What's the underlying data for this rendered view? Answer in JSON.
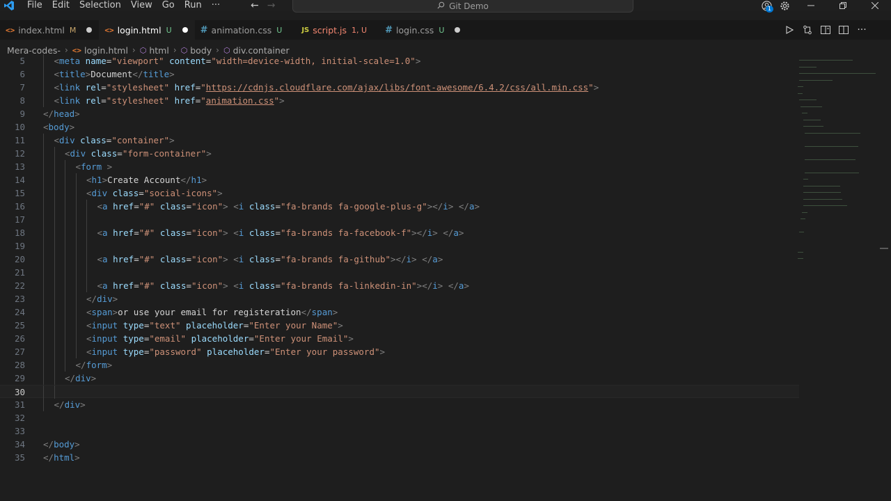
{
  "menu": [
    "File",
    "Edit",
    "Selection",
    "View",
    "Go",
    "Run",
    "···"
  ],
  "command_center": {
    "label": "Git Demo"
  },
  "account_badge": "1",
  "tabs": [
    {
      "label": "index.html",
      "status": "M",
      "kind": "html",
      "active": false,
      "dirty": true
    },
    {
      "label": "login.html",
      "status": "U",
      "kind": "html",
      "active": true,
      "dirty": true
    },
    {
      "label": "animation.css",
      "status": "U",
      "kind": "css",
      "active": false,
      "dirty": false
    },
    {
      "label": "script.js",
      "status": "1, U",
      "kind": "js",
      "active": false,
      "dirty": false
    },
    {
      "label": "login.css",
      "status": "U",
      "kind": "css",
      "active": false,
      "dirty": true
    }
  ],
  "breadcrumb": {
    "folder": "Mera-codes-",
    "file": "login.html",
    "html": "html",
    "body": "body",
    "div": "div.container"
  },
  "editor": {
    "current_line": "30",
    "lines": [
      {
        "n": "5",
        "indent": 1,
        "tokens": [
          [
            "br",
            "<"
          ],
          [
            "tag",
            "meta"
          ],
          [
            "t",
            " "
          ],
          [
            "attr",
            "name"
          ],
          [
            "eq",
            "="
          ],
          [
            "str",
            "\"viewport\""
          ],
          [
            "t",
            " "
          ],
          [
            "attr",
            "content"
          ],
          [
            "eq",
            "="
          ],
          [
            "str",
            "\"width=device-width, initial-scale=1.0\""
          ],
          [
            "br",
            ">"
          ]
        ]
      },
      {
        "n": "6",
        "indent": 1,
        "tokens": [
          [
            "br",
            "<"
          ],
          [
            "tag",
            "title"
          ],
          [
            "br",
            ">"
          ],
          [
            "t",
            "Document"
          ],
          [
            "br",
            "</"
          ],
          [
            "tag",
            "title"
          ],
          [
            "br",
            ">"
          ]
        ]
      },
      {
        "n": "7",
        "indent": 1,
        "tokens": [
          [
            "br",
            "<"
          ],
          [
            "tag",
            "link"
          ],
          [
            "t",
            " "
          ],
          [
            "attr",
            "rel"
          ],
          [
            "eq",
            "="
          ],
          [
            "str",
            "\"stylesheet\""
          ],
          [
            "t",
            " "
          ],
          [
            "attr",
            "href"
          ],
          [
            "eq",
            "="
          ],
          [
            "str",
            "\""
          ],
          [
            "link",
            "https://cdnjs.cloudflare.com/ajax/libs/font-awesome/6.4.2/css/all.min.css"
          ],
          [
            "str",
            "\""
          ],
          [
            "br",
            ">"
          ]
        ]
      },
      {
        "n": "8",
        "indent": 1,
        "tokens": [
          [
            "br",
            "<"
          ],
          [
            "tag",
            "link"
          ],
          [
            "t",
            " "
          ],
          [
            "attr",
            "rel"
          ],
          [
            "eq",
            "="
          ],
          [
            "str",
            "\"stylesheet\""
          ],
          [
            "t",
            " "
          ],
          [
            "attr",
            "href"
          ],
          [
            "eq",
            "="
          ],
          [
            "str",
            "\""
          ],
          [
            "link",
            "animation.css"
          ],
          [
            "str",
            "\""
          ],
          [
            "br",
            ">"
          ]
        ]
      },
      {
        "n": "9",
        "indent": 0,
        "tokens": [
          [
            "br",
            "</"
          ],
          [
            "tag",
            "head"
          ],
          [
            "br",
            ">"
          ]
        ]
      },
      {
        "n": "10",
        "indent": 0,
        "tokens": [
          [
            "br",
            "<"
          ],
          [
            "tag",
            "body"
          ],
          [
            "br",
            ">"
          ]
        ]
      },
      {
        "n": "11",
        "indent": 1,
        "tokens": [
          [
            "br",
            "<"
          ],
          [
            "tag",
            "div"
          ],
          [
            "t",
            " "
          ],
          [
            "attr",
            "class"
          ],
          [
            "eq",
            "="
          ],
          [
            "str",
            "\"container\""
          ],
          [
            "br",
            ">"
          ]
        ]
      },
      {
        "n": "12",
        "indent": 2,
        "tokens": [
          [
            "br",
            "<"
          ],
          [
            "tag",
            "div"
          ],
          [
            "t",
            " "
          ],
          [
            "attr",
            "class"
          ],
          [
            "eq",
            "="
          ],
          [
            "str",
            "\"form-container\""
          ],
          [
            "br",
            ">"
          ]
        ]
      },
      {
        "n": "13",
        "indent": 3,
        "tokens": [
          [
            "br",
            "<"
          ],
          [
            "tag",
            "form"
          ],
          [
            "t",
            " "
          ],
          [
            "br",
            ">"
          ]
        ]
      },
      {
        "n": "14",
        "indent": 4,
        "tokens": [
          [
            "br",
            "<"
          ],
          [
            "tag",
            "h1"
          ],
          [
            "br",
            ">"
          ],
          [
            "t",
            "Create Account"
          ],
          [
            "br",
            "</"
          ],
          [
            "tag",
            "h1"
          ],
          [
            "br",
            ">"
          ]
        ]
      },
      {
        "n": "15",
        "indent": 4,
        "tokens": [
          [
            "br",
            "<"
          ],
          [
            "tag",
            "div"
          ],
          [
            "t",
            " "
          ],
          [
            "attr",
            "class"
          ],
          [
            "eq",
            "="
          ],
          [
            "str",
            "\"social-icons\""
          ],
          [
            "br",
            ">"
          ]
        ]
      },
      {
        "n": "16",
        "indent": 5,
        "tokens": [
          [
            "br",
            "<"
          ],
          [
            "tag",
            "a"
          ],
          [
            "t",
            " "
          ],
          [
            "attr",
            "href"
          ],
          [
            "eq",
            "="
          ],
          [
            "str",
            "\"#\""
          ],
          [
            "t",
            " "
          ],
          [
            "attr",
            "class"
          ],
          [
            "eq",
            "="
          ],
          [
            "str",
            "\"icon\""
          ],
          [
            "br",
            ">"
          ],
          [
            "t",
            " "
          ],
          [
            "br",
            "<"
          ],
          [
            "tag",
            "i"
          ],
          [
            "t",
            " "
          ],
          [
            "attr",
            "class"
          ],
          [
            "eq",
            "="
          ],
          [
            "str",
            "\"fa-brands fa-google-plus-g\""
          ],
          [
            "br",
            "></"
          ],
          [
            "tag",
            "i"
          ],
          [
            "br",
            ">"
          ],
          [
            "t",
            " "
          ],
          [
            "br",
            "</"
          ],
          [
            "tag",
            "a"
          ],
          [
            "br",
            ">"
          ]
        ]
      },
      {
        "n": "17",
        "indent": 5,
        "tokens": []
      },
      {
        "n": "18",
        "indent": 5,
        "tokens": [
          [
            "br",
            "<"
          ],
          [
            "tag",
            "a"
          ],
          [
            "t",
            " "
          ],
          [
            "attr",
            "href"
          ],
          [
            "eq",
            "="
          ],
          [
            "str",
            "\"#\""
          ],
          [
            "t",
            " "
          ],
          [
            "attr",
            "class"
          ],
          [
            "eq",
            "="
          ],
          [
            "str",
            "\"icon\""
          ],
          [
            "br",
            ">"
          ],
          [
            "t",
            " "
          ],
          [
            "br",
            "<"
          ],
          [
            "tag",
            "i"
          ],
          [
            "t",
            " "
          ],
          [
            "attr",
            "class"
          ],
          [
            "eq",
            "="
          ],
          [
            "str",
            "\"fa-brands fa-facebook-f\""
          ],
          [
            "br",
            "></"
          ],
          [
            "tag",
            "i"
          ],
          [
            "br",
            ">"
          ],
          [
            "t",
            " "
          ],
          [
            "br",
            "</"
          ],
          [
            "tag",
            "a"
          ],
          [
            "br",
            ">"
          ]
        ]
      },
      {
        "n": "19",
        "indent": 5,
        "tokens": []
      },
      {
        "n": "20",
        "indent": 5,
        "tokens": [
          [
            "br",
            "<"
          ],
          [
            "tag",
            "a"
          ],
          [
            "t",
            " "
          ],
          [
            "attr",
            "href"
          ],
          [
            "eq",
            "="
          ],
          [
            "str",
            "\"#\""
          ],
          [
            "t",
            " "
          ],
          [
            "attr",
            "class"
          ],
          [
            "eq",
            "="
          ],
          [
            "str",
            "\"icon\""
          ],
          [
            "br",
            ">"
          ],
          [
            "t",
            " "
          ],
          [
            "br",
            "<"
          ],
          [
            "tag",
            "i"
          ],
          [
            "t",
            " "
          ],
          [
            "attr",
            "class"
          ],
          [
            "eq",
            "="
          ],
          [
            "str",
            "\"fa-brands fa-github\""
          ],
          [
            "br",
            "></"
          ],
          [
            "tag",
            "i"
          ],
          [
            "br",
            ">"
          ],
          [
            "t",
            " "
          ],
          [
            "br",
            "</"
          ],
          [
            "tag",
            "a"
          ],
          [
            "br",
            ">"
          ]
        ]
      },
      {
        "n": "21",
        "indent": 5,
        "tokens": []
      },
      {
        "n": "22",
        "indent": 5,
        "tokens": [
          [
            "br",
            "<"
          ],
          [
            "tag",
            "a"
          ],
          [
            "t",
            " "
          ],
          [
            "attr",
            "href"
          ],
          [
            "eq",
            "="
          ],
          [
            "str",
            "\"#\""
          ],
          [
            "t",
            " "
          ],
          [
            "attr",
            "class"
          ],
          [
            "eq",
            "="
          ],
          [
            "str",
            "\"icon\""
          ],
          [
            "br",
            ">"
          ],
          [
            "t",
            " "
          ],
          [
            "br",
            "<"
          ],
          [
            "tag",
            "i"
          ],
          [
            "t",
            " "
          ],
          [
            "attr",
            "class"
          ],
          [
            "eq",
            "="
          ],
          [
            "str",
            "\"fa-brands fa-linkedin-in\""
          ],
          [
            "br",
            "></"
          ],
          [
            "tag",
            "i"
          ],
          [
            "br",
            ">"
          ],
          [
            "t",
            " "
          ],
          [
            "br",
            "</"
          ],
          [
            "tag",
            "a"
          ],
          [
            "br",
            ">"
          ]
        ]
      },
      {
        "n": "23",
        "indent": 4,
        "tokens": [
          [
            "br",
            "</"
          ],
          [
            "tag",
            "div"
          ],
          [
            "br",
            ">"
          ]
        ]
      },
      {
        "n": "24",
        "indent": 4,
        "tokens": [
          [
            "br",
            "<"
          ],
          [
            "tag",
            "span"
          ],
          [
            "br",
            ">"
          ],
          [
            "t",
            "or use your email for registeration"
          ],
          [
            "br",
            "</"
          ],
          [
            "tag",
            "span"
          ],
          [
            "br",
            ">"
          ]
        ]
      },
      {
        "n": "25",
        "indent": 4,
        "tokens": [
          [
            "br",
            "<"
          ],
          [
            "tag",
            "input"
          ],
          [
            "t",
            " "
          ],
          [
            "attr",
            "type"
          ],
          [
            "eq",
            "="
          ],
          [
            "str",
            "\"text\""
          ],
          [
            "t",
            " "
          ],
          [
            "attr",
            "placeholder"
          ],
          [
            "eq",
            "="
          ],
          [
            "str",
            "\"Enter your Name\""
          ],
          [
            "br",
            ">"
          ]
        ]
      },
      {
        "n": "26",
        "indent": 4,
        "tokens": [
          [
            "br",
            "<"
          ],
          [
            "tag",
            "input"
          ],
          [
            "t",
            " "
          ],
          [
            "attr",
            "type"
          ],
          [
            "eq",
            "="
          ],
          [
            "str",
            "\"email\""
          ],
          [
            "t",
            " "
          ],
          [
            "attr",
            "placeholder"
          ],
          [
            "eq",
            "="
          ],
          [
            "str",
            "\"Enter your Email\""
          ],
          [
            "br",
            ">"
          ]
        ]
      },
      {
        "n": "27",
        "indent": 4,
        "tokens": [
          [
            "br",
            "<"
          ],
          [
            "tag",
            "input"
          ],
          [
            "t",
            " "
          ],
          [
            "attr",
            "type"
          ],
          [
            "eq",
            "="
          ],
          [
            "str",
            "\"password\""
          ],
          [
            "t",
            " "
          ],
          [
            "attr",
            "placeholder"
          ],
          [
            "eq",
            "="
          ],
          [
            "str",
            "\"Enter your password\""
          ],
          [
            "br",
            ">"
          ]
        ]
      },
      {
        "n": "28",
        "indent": 3,
        "tokens": [
          [
            "br",
            "</"
          ],
          [
            "tag",
            "form"
          ],
          [
            "br",
            ">"
          ]
        ]
      },
      {
        "n": "29",
        "indent": 2,
        "tokens": [
          [
            "br",
            "</"
          ],
          [
            "tag",
            "div"
          ],
          [
            "br",
            ">"
          ]
        ]
      },
      {
        "n": "30",
        "indent": 2,
        "tokens": []
      },
      {
        "n": "31",
        "indent": 1,
        "tokens": [
          [
            "br",
            "</"
          ],
          [
            "tag",
            "div"
          ],
          [
            "br",
            ">"
          ]
        ]
      },
      {
        "n": "32",
        "indent": 0,
        "tokens": []
      },
      {
        "n": "33",
        "indent": 0,
        "tokens": []
      },
      {
        "n": "34",
        "indent": 0,
        "tokens": [
          [
            "br",
            "</"
          ],
          [
            "tag",
            "body"
          ],
          [
            "br",
            ">"
          ]
        ]
      },
      {
        "n": "35",
        "indent": 0,
        "tokens": [
          [
            "br",
            "</"
          ],
          [
            "tag",
            "html"
          ],
          [
            "br",
            ">"
          ]
        ]
      }
    ]
  }
}
